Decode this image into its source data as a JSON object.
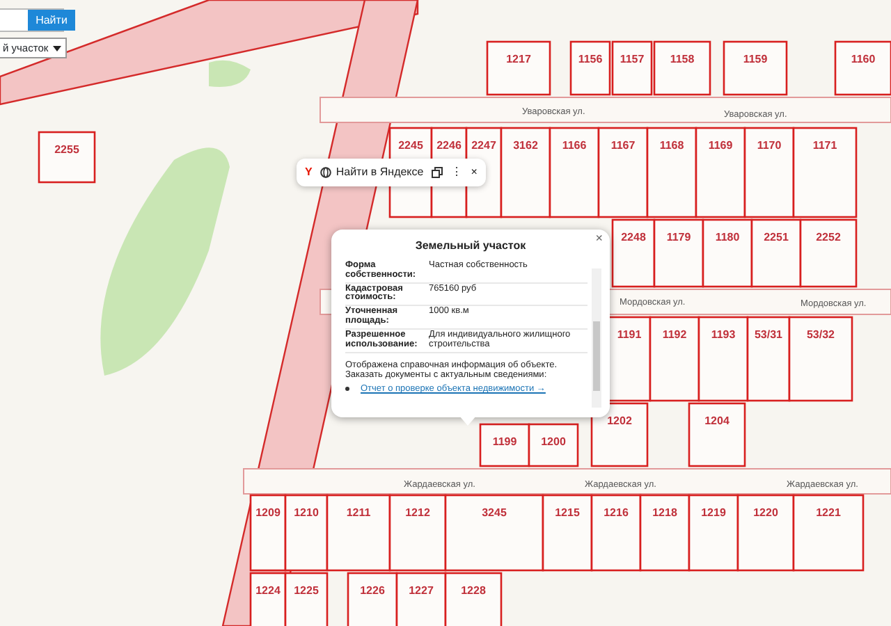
{
  "search": {
    "button": "Найти",
    "select": "й участок"
  },
  "map": {
    "streets": [
      {
        "name": "Уваровская ул."
      },
      {
        "name": "Уваровская ул."
      },
      {
        "name": "Мордовская ул."
      },
      {
        "name": "Мордовская ул."
      },
      {
        "name": "Жардаевская ул."
      },
      {
        "name": "Жардаевская ул."
      },
      {
        "name": "Жардаевская ул."
      }
    ],
    "parcels": [
      {
        "label": "1217"
      },
      {
        "label": "1156"
      },
      {
        "label": "1157"
      },
      {
        "label": "1158"
      },
      {
        "label": "1159"
      },
      {
        "label": "1160"
      },
      {
        "label": "2255"
      },
      {
        "label": "2245"
      },
      {
        "label": "2246"
      },
      {
        "label": "2247"
      },
      {
        "label": "3162"
      },
      {
        "label": "1166"
      },
      {
        "label": "1167"
      },
      {
        "label": "1168"
      },
      {
        "label": "1169"
      },
      {
        "label": "1170"
      },
      {
        "label": "1171"
      },
      {
        "label": "2248"
      },
      {
        "label": "1179"
      },
      {
        "label": "1180"
      },
      {
        "label": "2251"
      },
      {
        "label": "2252"
      },
      {
        "label": "1191"
      },
      {
        "label": "1192"
      },
      {
        "label": "1193"
      },
      {
        "label": "53/31"
      },
      {
        "label": "53/32"
      },
      {
        "label": "1199"
      },
      {
        "label": "1200"
      },
      {
        "label": "1202"
      },
      {
        "label": "1204"
      },
      {
        "label": "1209"
      },
      {
        "label": "1210"
      },
      {
        "label": "1211"
      },
      {
        "label": "1212"
      },
      {
        "label": "3245"
      },
      {
        "label": "1215"
      },
      {
        "label": "1216"
      },
      {
        "label": "1218"
      },
      {
        "label": "1219"
      },
      {
        "label": "1220"
      },
      {
        "label": "1221"
      },
      {
        "label": "1224"
      },
      {
        "label": "1225"
      },
      {
        "label": "1226"
      },
      {
        "label": "1227"
      },
      {
        "label": "1228"
      }
    ]
  },
  "yandex_toolbar": {
    "logo": "Y",
    "label": "Найти в Яндексе",
    "more": "⋮",
    "close": "×"
  },
  "popup": {
    "title": "Земельный участок",
    "close": "×",
    "rows": [
      {
        "label": "Форма собственности:",
        "value": "Частная собственность"
      },
      {
        "label": "Кадастровая стоимость:",
        "value": "765160 руб"
      },
      {
        "label": "Уточненная площадь:",
        "value": "1000 кв.м"
      },
      {
        "label": "Разрешенное использование:",
        "value": "Для индивидуального жилищного строительства"
      }
    ],
    "note": "Отображена справочная информация об объекте. Заказать документы с актуальным сведениями:",
    "link": "Отчет о проверке объекта недвижимости →"
  }
}
